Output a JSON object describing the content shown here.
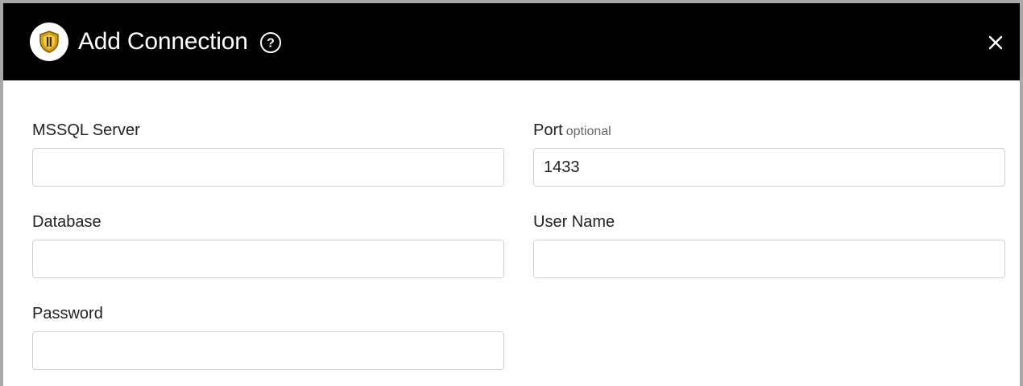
{
  "header": {
    "title": "Add Connection",
    "logo_icon": "shield-logo-icon",
    "help_icon": "question-circle-icon",
    "close_icon": "close-icon"
  },
  "form": {
    "server": {
      "label": "MSSQL Server",
      "value": ""
    },
    "port": {
      "label": "Port",
      "hint": "optional",
      "value": "1433"
    },
    "database": {
      "label": "Database",
      "value": ""
    },
    "username": {
      "label": "User Name",
      "value": ""
    },
    "password": {
      "label": "Password",
      "value": ""
    }
  },
  "colors": {
    "header_bg": "#000000",
    "header_text": "#ffffff",
    "logo_gold": "#d4a017",
    "input_border": "#cfcfcf"
  }
}
